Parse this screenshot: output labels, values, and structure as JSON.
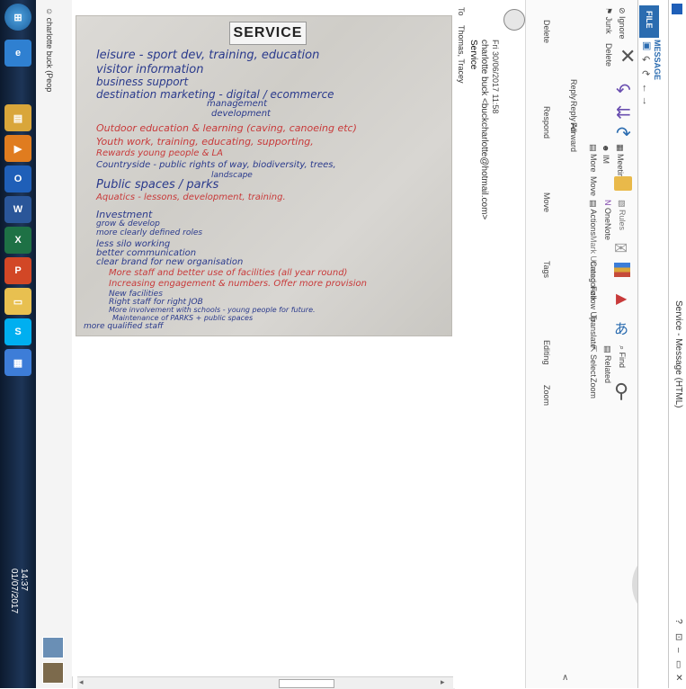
{
  "window": {
    "title": "Service - Message (HTML)",
    "controls": [
      "?",
      "⊡",
      "–",
      "▭",
      "✕"
    ]
  },
  "tabs": {
    "file": "FILE",
    "message": "MESSAGE"
  },
  "ribbon": {
    "delete_group": {
      "ignore": "Ignore",
      "junk": "Junk",
      "delete": "Delete",
      "label": "Delete"
    },
    "respond_group": {
      "reply": "Reply",
      "reply_all": "Reply All",
      "forward": "Forward",
      "meeting": "Meeting",
      "im": "IM",
      "more": "More",
      "label": "Respond"
    },
    "move_group": {
      "move": "Move",
      "rules": "Rules",
      "onenote": "OneNote",
      "actions": "Actions",
      "label": "Move"
    },
    "tags_group": {
      "mark_unread": "Mark Unread",
      "categorize": "Categorize",
      "follow_up": "Follow Up",
      "label": "Tags"
    },
    "editing_group": {
      "translate": "Translate",
      "find": "Find",
      "related": "Related",
      "select": "Select",
      "label": "Editing"
    },
    "zoom_group": {
      "zoom": "Zoom",
      "label": "Zoom"
    }
  },
  "message": {
    "date": "Fri 30/06/2017 11:58",
    "from": "charlotte buck <buckcharlotte@hotmail.com>",
    "subject": "Service",
    "to_label": "To",
    "to": "Thomas, Tracey"
  },
  "people_pane": {
    "name": "charlotte buck (Peop"
  },
  "photo": {
    "heading": "SERVICE",
    "lines_blue_1": [
      "leisure - sport dev, training, education",
      "visitor information",
      "business support",
      "destination marketing - digital / ecommerce",
      "management",
      "development"
    ],
    "lines_red_1": [
      "Outdoor education & learning (caving, canoeing etc)",
      "Youth work, training, educating, supporting,",
      "Rewards young people & LA"
    ],
    "lines_blue_2": [
      "Countryside - public rights of way, biodiversity, trees,",
      "landscape",
      "Public spaces / parks",
      "Aquatics - lessons, development, training."
    ],
    "lines_blue_3": [
      "Investment",
      "grow & develop",
      "more clearly defined roles",
      "less silo working",
      "better communication",
      "clear brand for new organisation"
    ],
    "lines_red_2": [
      "More staff and better use of facilities (all year round)",
      "Increasing engagement & numbers. Offer more provision"
    ],
    "lines_blue_4": [
      "New facilities",
      "Right staff for right JOB",
      "More involvement with schools - young people for future.",
      "Maintenance of PARKS + public spaces",
      "more qualified staff"
    ]
  },
  "taskbar": {
    "time": "14:37",
    "date": "01/07/2017"
  },
  "colors": {
    "accent": "#2b6cb0",
    "ink_blue": "#2a3a8c",
    "ink_red": "#c83a3a"
  }
}
